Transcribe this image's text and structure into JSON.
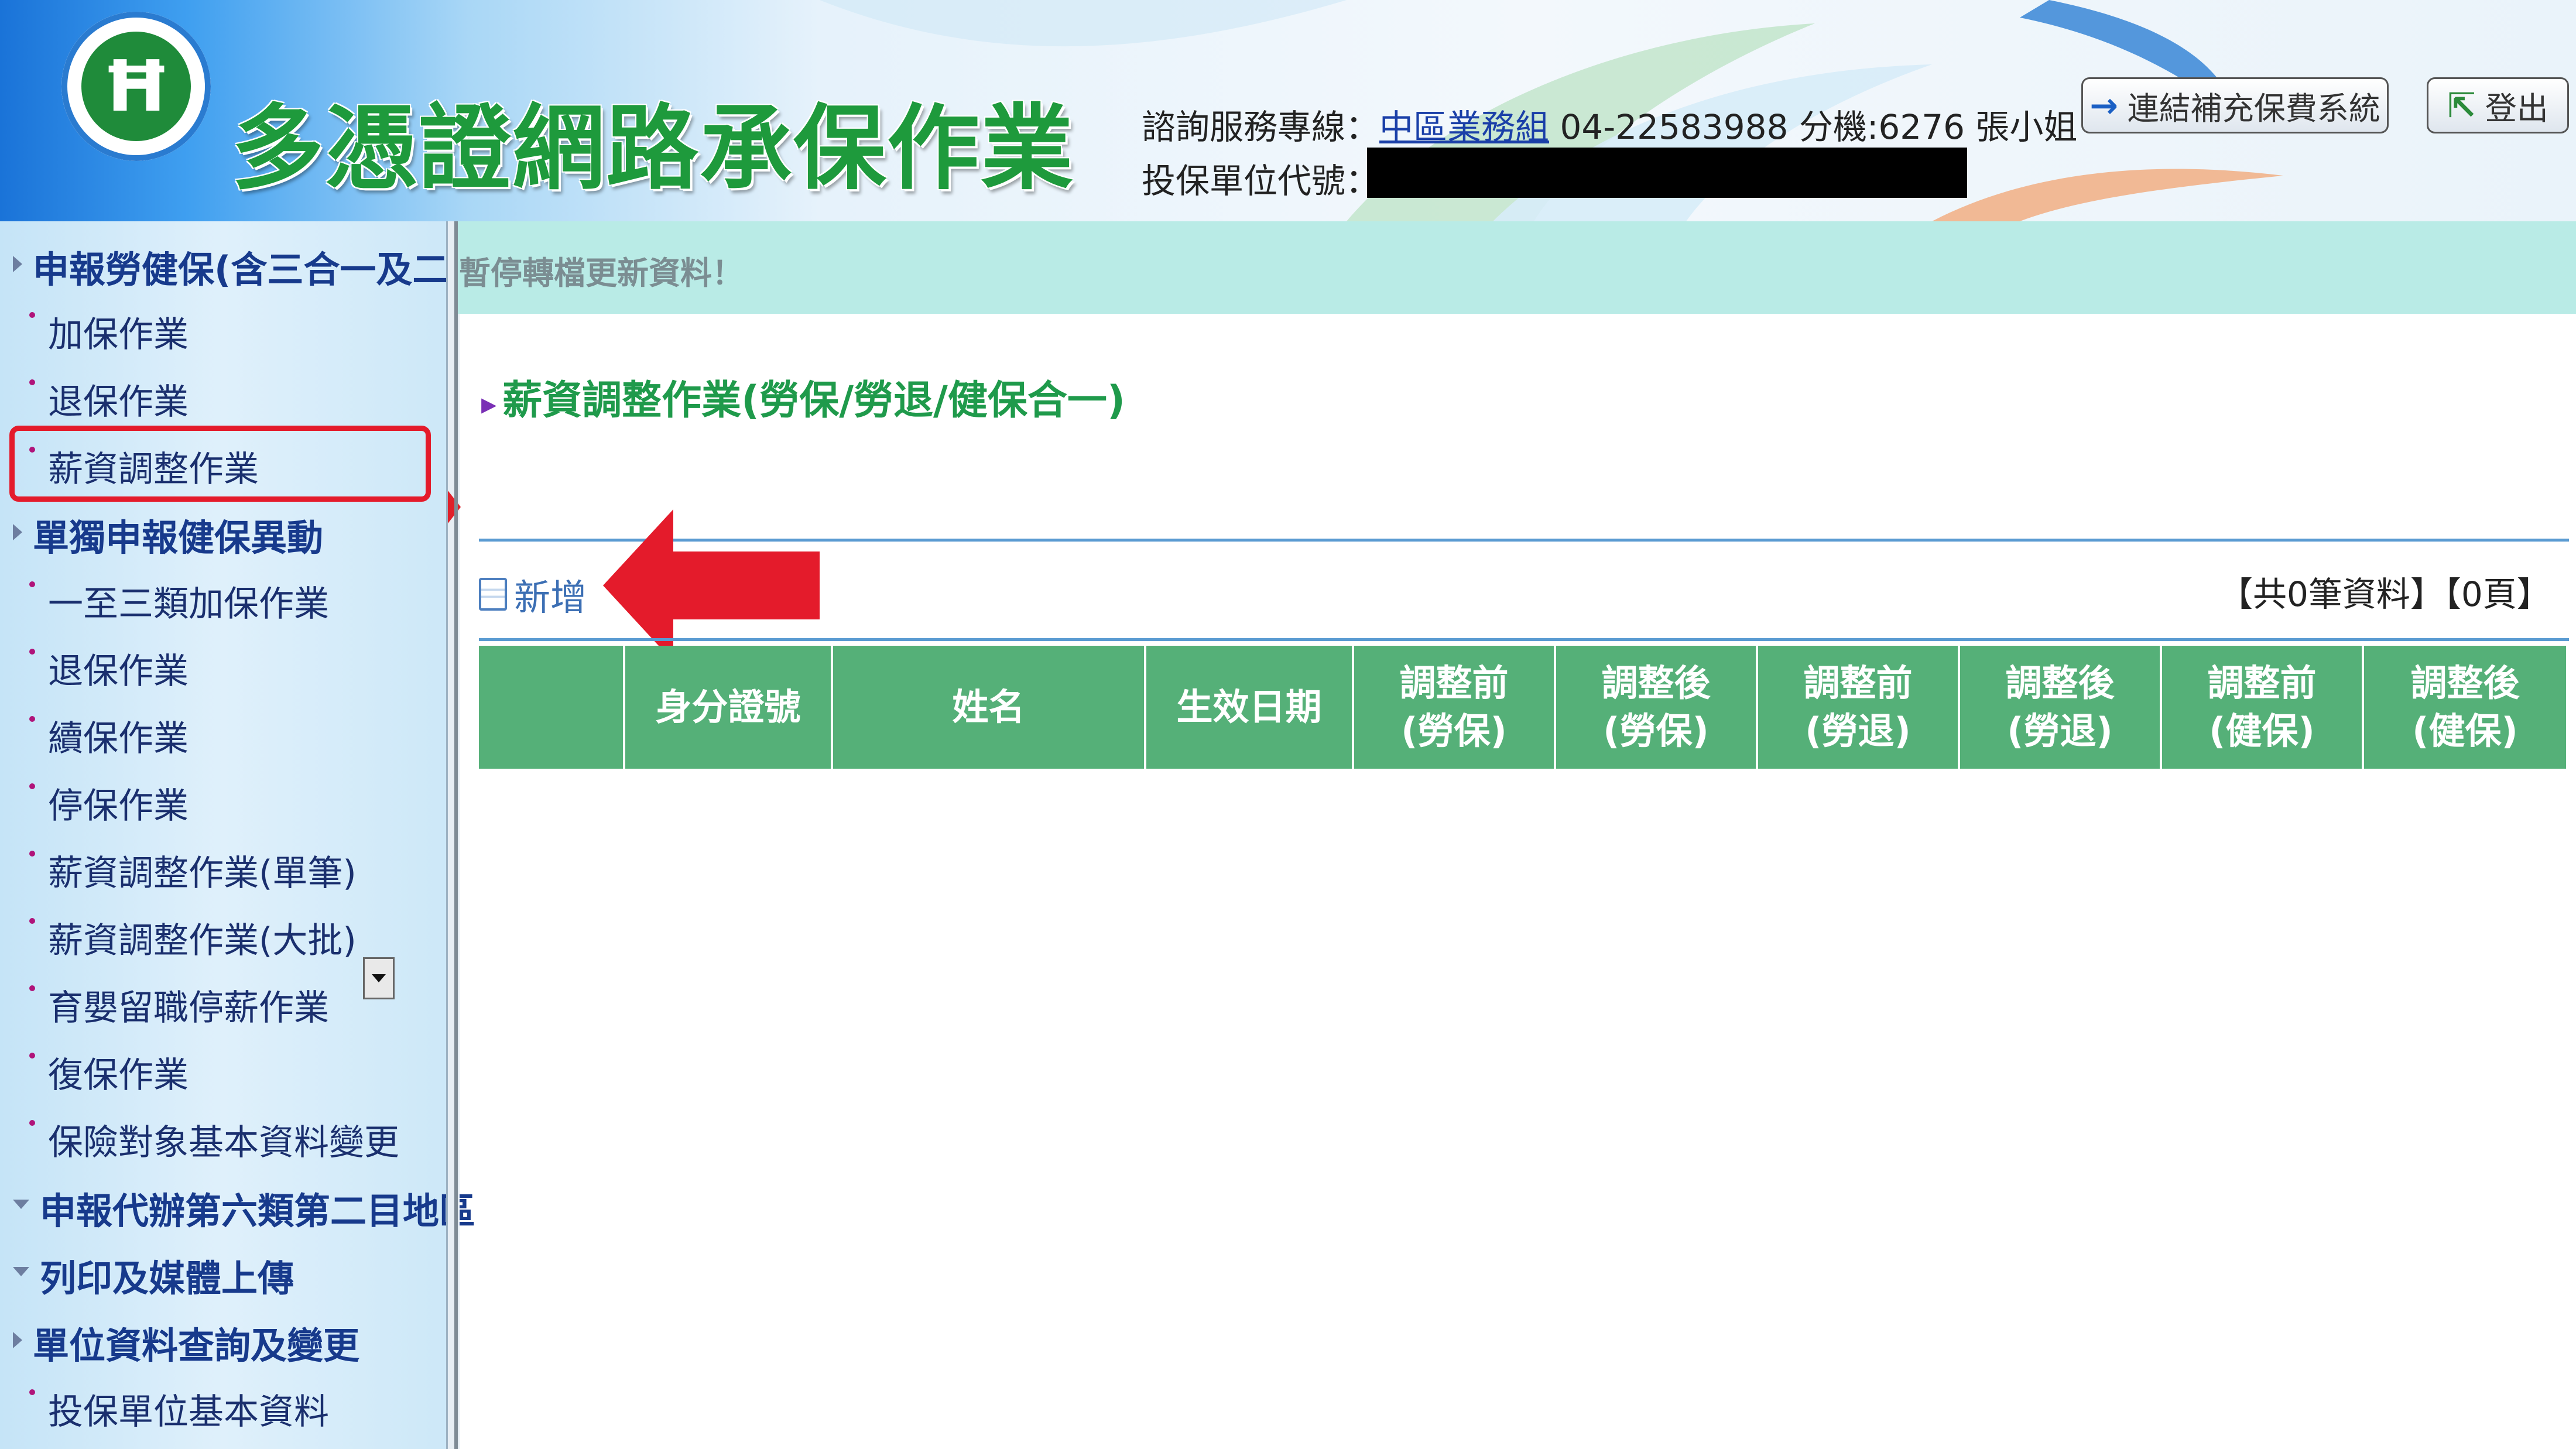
{
  "header": {
    "title": "多憑證網路承保作業",
    "hotline_label": "諮詢服務專線：",
    "hotline_link": "中區業務組",
    "hotline_number": " 04-22583988 分機:6276 張小姐",
    "unit_code_label": "投保單位代號：",
    "link_button": "連結補充保費系統",
    "logout_button": "登出"
  },
  "sidebar": {
    "items": [
      {
        "type": "cat",
        "label": "申報勞健保(含三合一及二",
        "icon": "triangle-right"
      },
      {
        "type": "sub",
        "label": "加保作業"
      },
      {
        "type": "sub",
        "label": "退保作業"
      },
      {
        "type": "sub",
        "label": "薪資調整作業",
        "highlighted": true
      },
      {
        "type": "cat",
        "label": "單獨申報健保異動",
        "icon": "triangle-right"
      },
      {
        "type": "sub",
        "label": "一至三類加保作業"
      },
      {
        "type": "sub",
        "label": "退保作業"
      },
      {
        "type": "sub",
        "label": "續保作業"
      },
      {
        "type": "sub",
        "label": "停保作業"
      },
      {
        "type": "sub",
        "label": "薪資調整作業(單筆)"
      },
      {
        "type": "sub",
        "label": "薪資調整作業(大批)"
      },
      {
        "type": "sub",
        "label": "育嬰留職停薪作業"
      },
      {
        "type": "sub",
        "label": "復保作業"
      },
      {
        "type": "sub",
        "label": "保險對象基本資料變更"
      },
      {
        "type": "cat",
        "label": "申報代辦第六類第二目地區",
        "icon": "triangle-down"
      },
      {
        "type": "cat",
        "label": "列印及媒體上傳",
        "icon": "triangle-down"
      },
      {
        "type": "cat",
        "label": "單位資料查詢及變更",
        "icon": "triangle-right"
      },
      {
        "type": "sub",
        "label": "投保單位基本資料"
      }
    ],
    "highlight_color": "#e41b2b"
  },
  "main": {
    "notice": "暫停轉檔更新資料！",
    "section_title": "薪資調整作業(勞保/勞退/健保合一)",
    "add_label": "新增",
    "record_count": "【共0筆資料】【0頁】",
    "table_headers": [
      {
        "l1": "",
        "l2": ""
      },
      {
        "l1": "身分證號",
        "l2": ""
      },
      {
        "l1": "姓名",
        "l2": ""
      },
      {
        "l1": "生效日期",
        "l2": ""
      },
      {
        "l1": "調整前",
        "l2": "(勞保)"
      },
      {
        "l1": "調整後",
        "l2": "(勞保)"
      },
      {
        "l1": "調整前",
        "l2": "(勞退)"
      },
      {
        "l1": "調整後",
        "l2": "(勞退)"
      },
      {
        "l1": "調整前",
        "l2": "(健保)"
      },
      {
        "l1": "調整後",
        "l2": "(健保)"
      }
    ]
  },
  "colors": {
    "table_header_bg": "#55b078",
    "notice_bg": "#b9ebe6",
    "title_green": "#1e9a3c",
    "annotation_red": "#e41b2b"
  }
}
